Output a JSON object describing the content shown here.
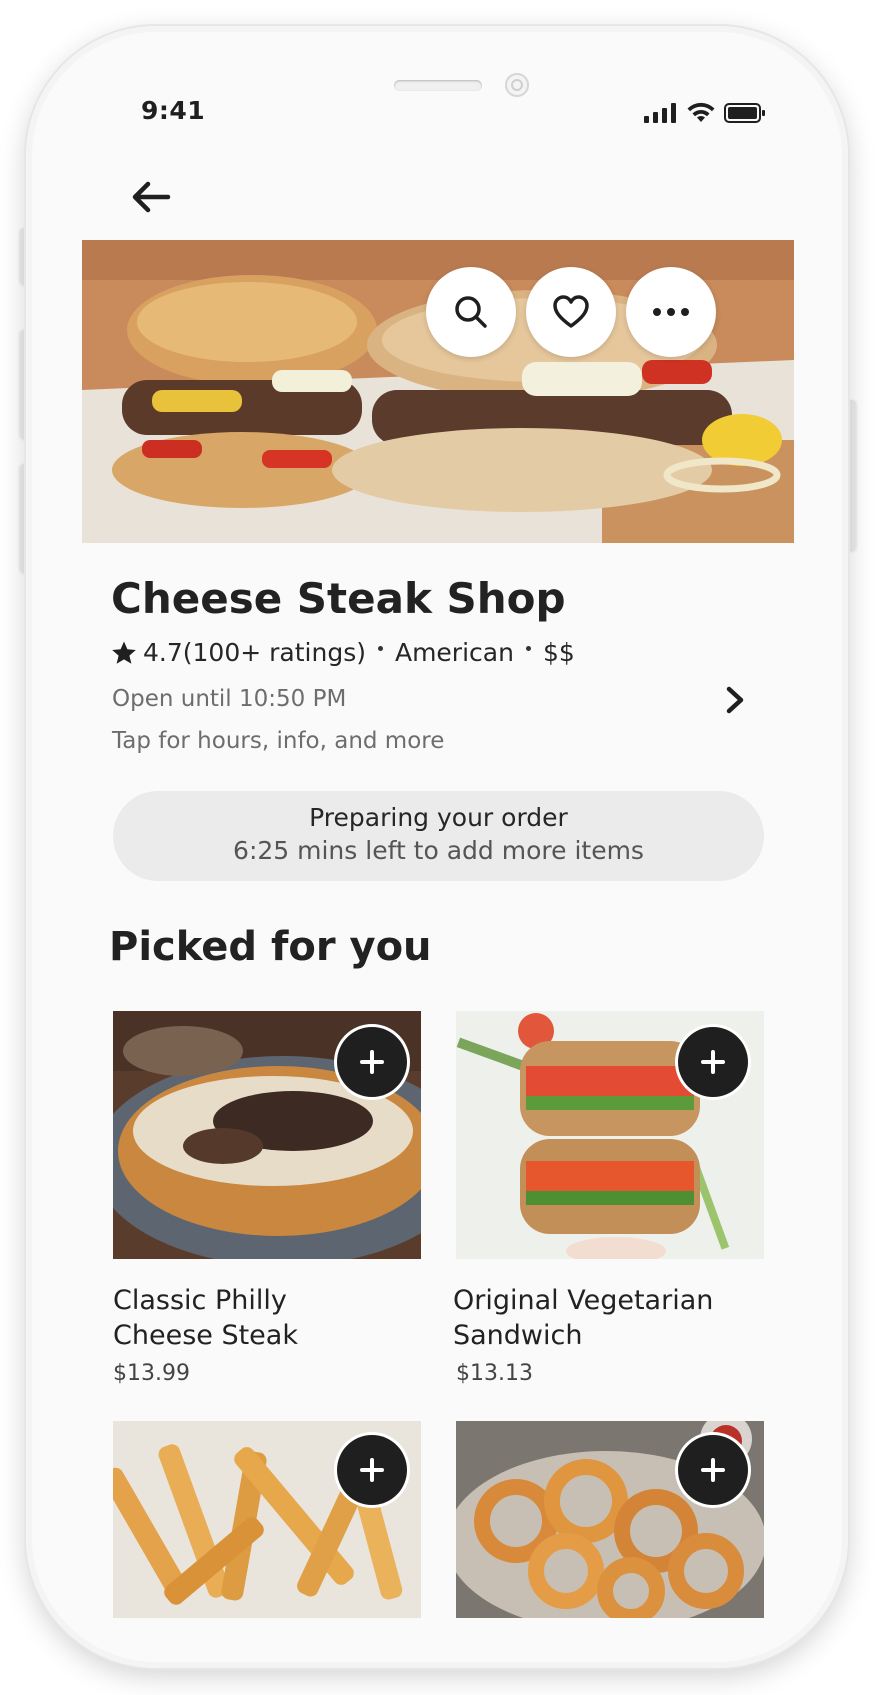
{
  "status_bar": {
    "time": "9:41"
  },
  "restaurant": {
    "name": "Cheese Steak Shop",
    "rating": "4.7",
    "ratings_count": "(100+ ratings)",
    "cuisine": "American",
    "price_level": "$$",
    "hours": "Open until 10:50 PM",
    "info_hint": "Tap for hours, info, and more"
  },
  "order_status": {
    "title": "Preparing your order",
    "subtitle": "6:25 mins left to add more items"
  },
  "section": {
    "title": "Picked for you"
  },
  "items": [
    {
      "name_line1": "Classic Philly",
      "name_line2": "Cheese Steak",
      "price": "$13.99"
    },
    {
      "name_line1": "Original Vegetarian",
      "name_line2": "Sandwich",
      "price": "$13.13"
    },
    {
      "name_line1": "",
      "name_line2": "",
      "price": ""
    },
    {
      "name_line1": "",
      "name_line2": "",
      "price": ""
    }
  ],
  "icons": {
    "back": "arrow-left-icon",
    "search": "search-icon",
    "favorite": "heart-icon",
    "more": "more-horizontal-icon",
    "add": "plus-icon",
    "chevron": "chevron-right-icon"
  },
  "colors": {
    "background": "#fafafa",
    "pill": "#ebebeb",
    "add_button": "#1f1f1f",
    "text_primary": "#222222",
    "text_secondary": "#6d6d6d"
  }
}
